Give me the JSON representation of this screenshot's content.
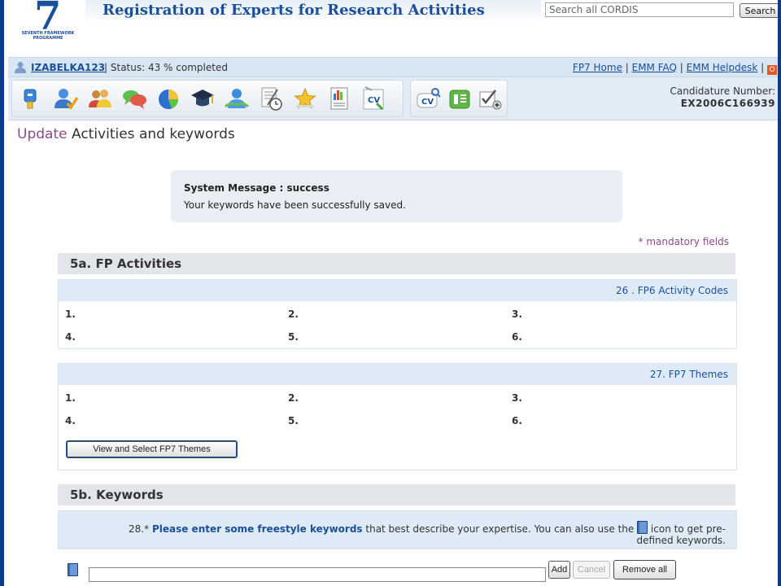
{
  "header": {
    "logo_number": "7",
    "logo_text": "SEVENTH FRAMEWORK PROGRAMME",
    "site_title": "Registration of Experts for Research Activities",
    "search_placeholder": "Search all CORDIS",
    "search_button": "Search"
  },
  "status_bar": {
    "username": "IZABELKA123",
    "separator": "|",
    "status": "Status: 43 % completed",
    "links": [
      "FP7 Home",
      "EMM FAQ",
      "EMM Helpdesk"
    ],
    "logout_glyph": "O"
  },
  "toolbar": {
    "icons": [
      "identification-icon",
      "personal-data-icon",
      "contact-icon",
      "languages-icon",
      "activities-icon",
      "education-icon",
      "professional-experience-icon",
      "publications-icon",
      "star-icon",
      "statistics-icon",
      "cv-upload-icon"
    ],
    "extra_icons": [
      "cv-view-icon",
      "summary-icon",
      "submit-icon"
    ],
    "cv_label": "CV",
    "candidature_label": "Candidature Number:",
    "candidature_number": "EX2006C166939"
  },
  "page": {
    "title_prefix": "Update",
    "title": " Activities and keywords"
  },
  "system_message": {
    "title": "System Message : success",
    "text": "Your keywords have been successfully saved."
  },
  "mandatory_note": "* mandatory fields",
  "section_5a": {
    "title": "5a. FP Activities",
    "fp6": {
      "header": "26 . FP6 Activity Codes",
      "items": [
        "1.",
        "2.",
        "3.",
        "4.",
        "5.",
        "6."
      ]
    },
    "fp7": {
      "header": "27. FP7 Themes",
      "items": [
        "1.",
        "2.",
        "3.",
        "4.",
        "5.",
        "6."
      ],
      "button": "View and Select FP7 Themes"
    }
  },
  "section_5b": {
    "title": "5b. Keywords",
    "prompt_number": "28.*",
    "prompt_bold": "Please enter some freestyle keywords",
    "prompt_rest": " that best describe your expertise. You can also use the ",
    "prompt_end": " icon to get pre-defined keywords.",
    "keyword_value": "",
    "add_button": "Add",
    "cancel_button": "Cancel",
    "remove_button": "Remove all"
  }
}
